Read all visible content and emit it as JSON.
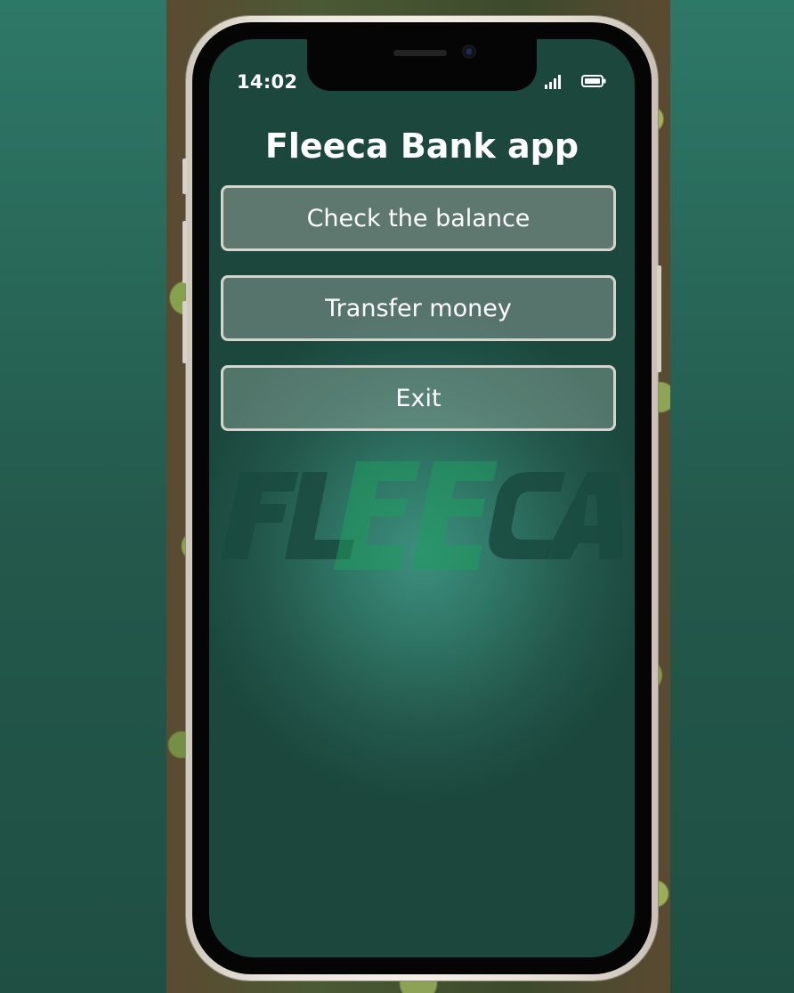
{
  "status_bar": {
    "time": "14:02",
    "signal_icon": "signal-bars-icon",
    "battery_icon": "battery-icon"
  },
  "app": {
    "title": "Fleeca Bank app",
    "buttons": [
      {
        "label": "Check the balance"
      },
      {
        "label": "Transfer money"
      },
      {
        "label": "Exit"
      }
    ],
    "logo_text": "FLEECA"
  },
  "colors": {
    "background": "#2e7867",
    "screen_accent": "#3d8f7e",
    "logo_green": "#1f9a5e",
    "logo_dark": "#1a4a3f"
  }
}
